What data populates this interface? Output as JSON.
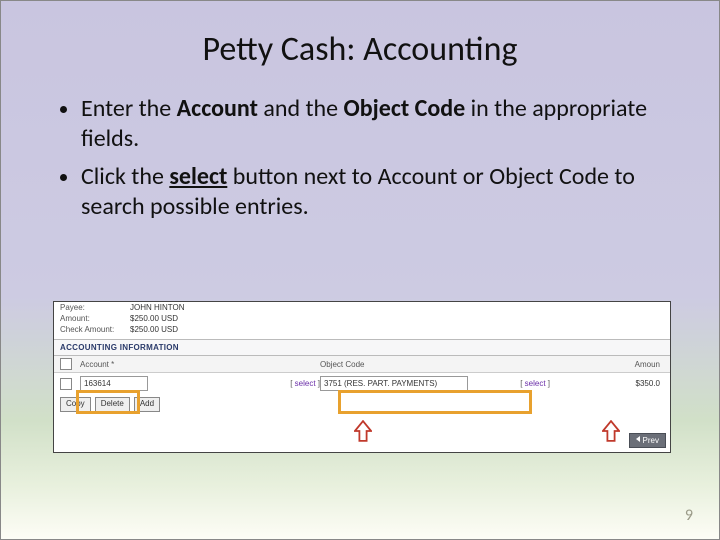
{
  "title": "Petty Cash: Accounting",
  "bullets": {
    "b1_pre": "Enter the ",
    "b1_bold1": "Account",
    "b1_mid": " and the ",
    "b1_bold2": "Object Code",
    "b1_post": " in the appropriate fields.",
    "b2_pre": "Click the ",
    "b2_bold_u": "select",
    "b2_post": " button next to Account or Object Code to search possible entries."
  },
  "screenshot": {
    "payee_label": "Payee:",
    "payee_value": "JOHN HINTON",
    "amount_label": "Amount:",
    "amount_value": "$250.00 USD",
    "check_amount_label": "Check Amount:",
    "check_amount_value": "$250.00 USD",
    "section_title": "ACCOUNTING INFORMATION",
    "col_account": "Account *",
    "col_object": "Object Code",
    "col_amount": "Amoun",
    "row_account": "163614",
    "row_object": "3751 (RES. PART. PAYMENTS)",
    "row_amount": "$350.0",
    "select_left": "select",
    "select_right": "select",
    "btn_copy": "Copy",
    "btn_delete": "Delete",
    "btn_add": "Add",
    "nav_prev": "Prev"
  },
  "page_number": "9"
}
